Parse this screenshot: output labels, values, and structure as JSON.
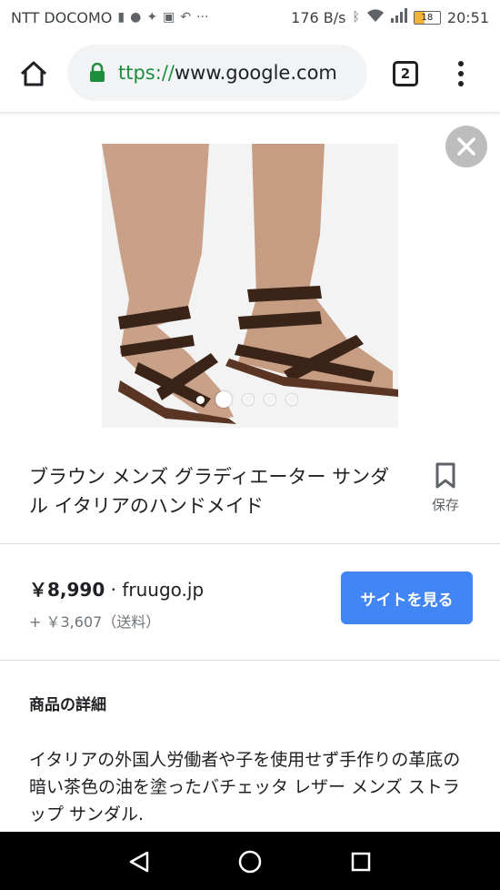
{
  "status_bar": {
    "carrier": "NTT DOCOMO",
    "speed": "176 B/s",
    "battery": "18",
    "time": "20:51",
    "icons": [
      "sim-icon",
      "wechat-icon",
      "twitter-icon",
      "app-icon",
      "reply-icon",
      "more-icon",
      "bluetooth-icon",
      "wifi-icon",
      "signal-icon",
      "battery-icon"
    ]
  },
  "browser": {
    "url_scheme": "ttps://",
    "url_host": "www.google.com",
    "tab_count": "2"
  },
  "product": {
    "image_alt": "brown gladiator sandals",
    "carousel_total": 5,
    "carousel_active": 2,
    "title": "ブラウン メンズ グラディエーター サンダル イタリアのハンドメイド",
    "save_label": "保存",
    "price": "￥8,990",
    "separator": " · ",
    "store": "fruugo.jp",
    "shipping": "+ ￥3,607（送料）",
    "visit_label": "サイトを見る",
    "details_heading": "商品の詳細",
    "details_text": "イタリアの外国人労働者や子を使用せず手作りの革底の暗い茶色の油を塗ったバチェッタ レザー メンズ ストラップ サンダル."
  },
  "colors": {
    "accent": "#4285f4",
    "secure": "#1e8e3e"
  }
}
